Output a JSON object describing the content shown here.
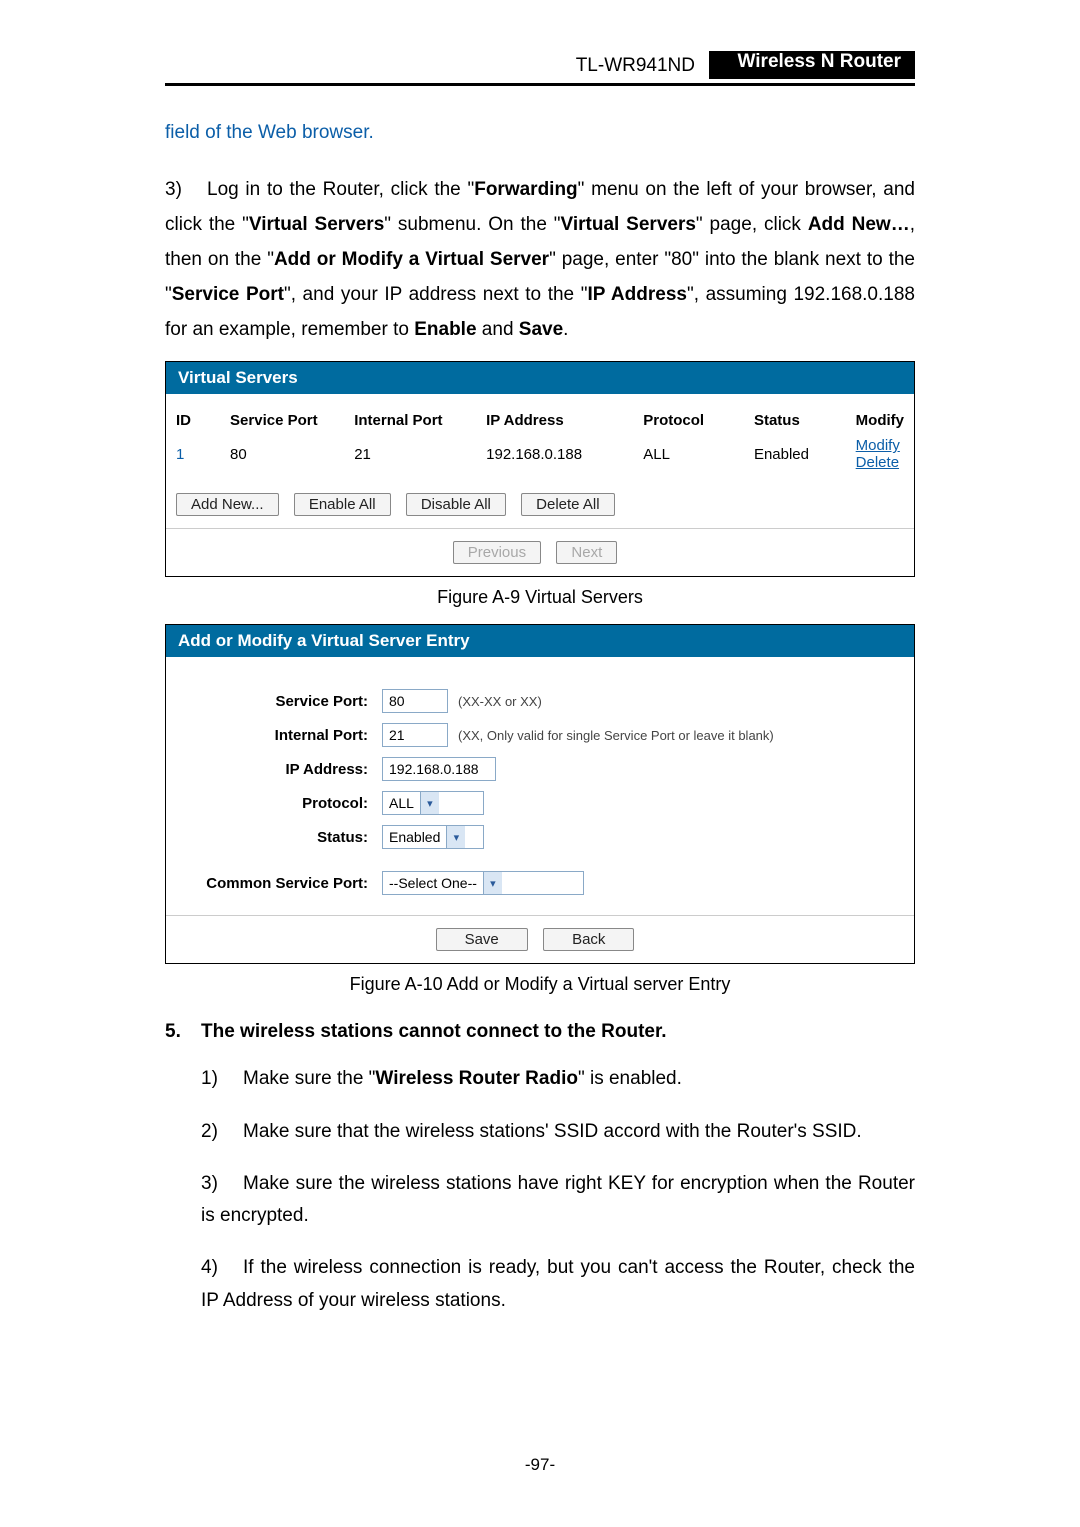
{
  "header": {
    "model": "TL-WR941ND",
    "product": "Wireless  N  Router"
  },
  "intro": "field of the Web browser.",
  "step3": {
    "num": "3)",
    "p1a": "Log in to the Router, click the \"",
    "fw": "Forwarding",
    "p1b": "\" menu on the left of your browser, and click the \"",
    "vs": "Virtual Servers",
    "p1c": "\" submenu. On the \"",
    "vs2": "Virtual Servers",
    "p1d": "\" page, click ",
    "add": "Add New…",
    "p1e": ", then on the \"",
    "amvs": "Add or Modify a Virtual Server",
    "p1f": "\" page, enter \"80\" into the blank next to the \"",
    "sp": "Service Port",
    "p1g": "\", and your IP address next to the \"",
    "ipa": "IP Address",
    "p1h": "\", assuming 192.168.0.188 for an example, remember to ",
    "en": "Enable",
    "and": " and ",
    "sv": "Save",
    "dot": "."
  },
  "vs": {
    "title": "Virtual Servers",
    "cols": {
      "id": "ID",
      "sp": "Service Port",
      "ip": "Internal Port",
      "addr": "IP Address",
      "proto": "Protocol",
      "st": "Status",
      "mod": "Modify"
    },
    "row": {
      "id": "1",
      "sp": "80",
      "ip": "21",
      "addr": "192.168.0.188",
      "proto": "ALL",
      "st": "Enabled",
      "m": "Modify",
      "d": "Delete"
    },
    "btns": {
      "add": "Add New...",
      "ena": "Enable All",
      "dis": "Disable All",
      "del": "Delete All",
      "prev": "Previous",
      "next": "Next"
    },
    "cap": "Figure A-9    Virtual Servers"
  },
  "am": {
    "title": "Add or Modify a Virtual Server Entry",
    "labels": {
      "sp": "Service Port:",
      "ip": "Internal Port:",
      "addr": "IP Address:",
      "proto": "Protocol:",
      "st": "Status:",
      "csp": "Common Service Port:"
    },
    "vals": {
      "sp": "80",
      "ip": "21",
      "addr": "192.168.0.188",
      "proto": "ALL",
      "st": "Enabled",
      "csp": "--Select One--"
    },
    "hints": {
      "sp": "(XX-XX or XX)",
      "ip": "(XX, Only valid for single Service Port or leave it blank)"
    },
    "btns": {
      "save": "Save",
      "back": "Back"
    },
    "cap": "Figure A-10    Add or Modify a Virtual server Entry"
  },
  "sec5": {
    "num": "5.",
    "title": "The wireless stations cannot connect to the Router."
  },
  "s5li": {
    "l1n": "1)",
    "l1a": "Make sure the \"",
    "l1b": "Wireless Router Radio",
    "l1c": "\" is enabled.",
    "l2n": "2)",
    "l2": "Make sure that the wireless stations' SSID accord with the Router's SSID.",
    "l3n": "3)",
    "l3": "Make sure the wireless stations have right KEY for encryption when the Router is encrypted.",
    "l4n": "4)",
    "l4": "If the wireless connection is ready, but you can't access the Router, check the IP Address of your wireless stations."
  },
  "footer": "-97-"
}
